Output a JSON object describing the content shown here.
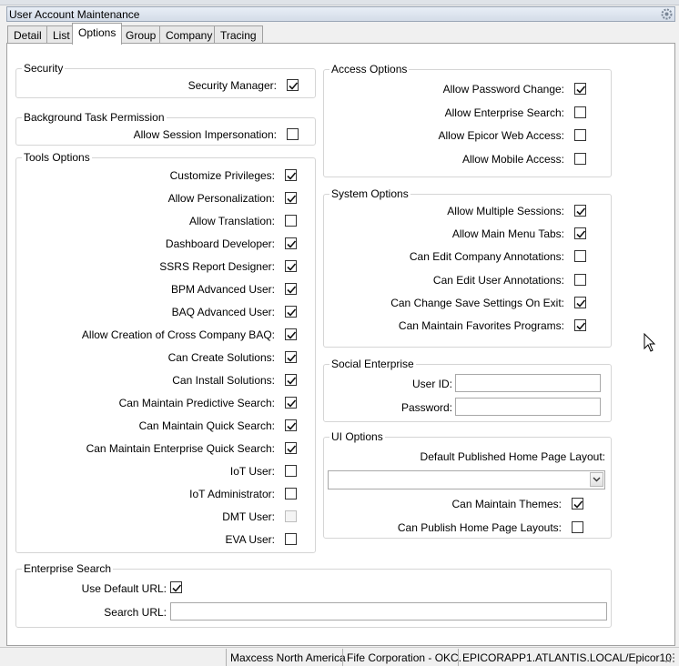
{
  "window": {
    "title": "User Account Maintenance",
    "settings_icon": "gear-icon"
  },
  "tabs": [
    {
      "label": "Detail",
      "active": false
    },
    {
      "label": "List",
      "active": false
    },
    {
      "label": "Options",
      "active": true
    },
    {
      "label": "Group",
      "active": false
    },
    {
      "label": "Company",
      "active": false
    },
    {
      "label": "Tracing",
      "active": false
    }
  ],
  "security": {
    "title": "Security",
    "items": [
      {
        "label": "Security Manager:",
        "checked": true
      }
    ]
  },
  "background_task": {
    "title": "Background Task Permission",
    "items": [
      {
        "label": "Allow Session Impersonation:",
        "checked": false
      }
    ]
  },
  "tools_options": {
    "title": "Tools Options",
    "items": [
      {
        "label": "Customize Privileges:",
        "checked": true
      },
      {
        "label": "Allow Personalization:",
        "checked": true
      },
      {
        "label": "Allow Translation:",
        "checked": false
      },
      {
        "label": "Dashboard Developer:",
        "checked": true
      },
      {
        "label": "SSRS Report Designer:",
        "checked": true
      },
      {
        "label": "BPM Advanced User:",
        "checked": true
      },
      {
        "label": "BAQ Advanced User:",
        "checked": true
      },
      {
        "label": "Allow Creation of Cross Company BAQ:",
        "checked": true
      },
      {
        "label": "Can Create Solutions:",
        "checked": true
      },
      {
        "label": "Can Install Solutions:",
        "checked": true
      },
      {
        "label": "Can Maintain Predictive Search:",
        "checked": true
      },
      {
        "label": "Can Maintain Quick Search:",
        "checked": true
      },
      {
        "label": "Can Maintain Enterprise Quick Search:",
        "checked": true
      },
      {
        "label": "IoT User:",
        "checked": false
      },
      {
        "label": "IoT Administrator:",
        "checked": false
      },
      {
        "label": "DMT User:",
        "checked": false,
        "disabled": true
      },
      {
        "label": "EVA User:",
        "checked": false
      }
    ]
  },
  "access_options": {
    "title": "Access Options",
    "items": [
      {
        "label": "Allow Password Change:",
        "checked": true
      },
      {
        "label": "Allow Enterprise Search:",
        "checked": false
      },
      {
        "label": "Allow Epicor Web Access:",
        "checked": false
      },
      {
        "label": "Allow Mobile Access:",
        "checked": false
      }
    ]
  },
  "system_options": {
    "title": "System Options",
    "items": [
      {
        "label": "Allow Multiple Sessions:",
        "checked": true
      },
      {
        "label": "Allow Main Menu Tabs:",
        "checked": true
      },
      {
        "label": "Can Edit Company Annotations:",
        "checked": false
      },
      {
        "label": "Can Edit User Annotations:",
        "checked": false
      },
      {
        "label": "Can Change Save Settings On Exit:",
        "checked": true
      },
      {
        "label": "Can Maintain Favorites Programs:",
        "checked": true
      }
    ]
  },
  "social_enterprise": {
    "title": "Social Enterprise",
    "user_id_label": "User ID:",
    "user_id_value": "",
    "password_label": "Password:",
    "password_value": ""
  },
  "ui_options": {
    "title": "UI Options",
    "layout_label": "Default Published Home Page Layout:",
    "layout_value": "",
    "items": [
      {
        "label": "Can Maintain Themes:",
        "checked": true
      },
      {
        "label": "Can Publish Home Page Layouts:",
        "checked": false
      }
    ]
  },
  "enterprise_search": {
    "title": "Enterprise Search",
    "use_default_label": "Use Default URL:",
    "use_default_checked": true,
    "search_url_label": "Search URL:",
    "search_url_value": ""
  },
  "statusbar": {
    "panels": [
      "Maxcess North America",
      "Fife Corporation - OKC.",
      "EPICORAPP1.ATLANTIS.LOCAL/Epicor10"
    ]
  }
}
